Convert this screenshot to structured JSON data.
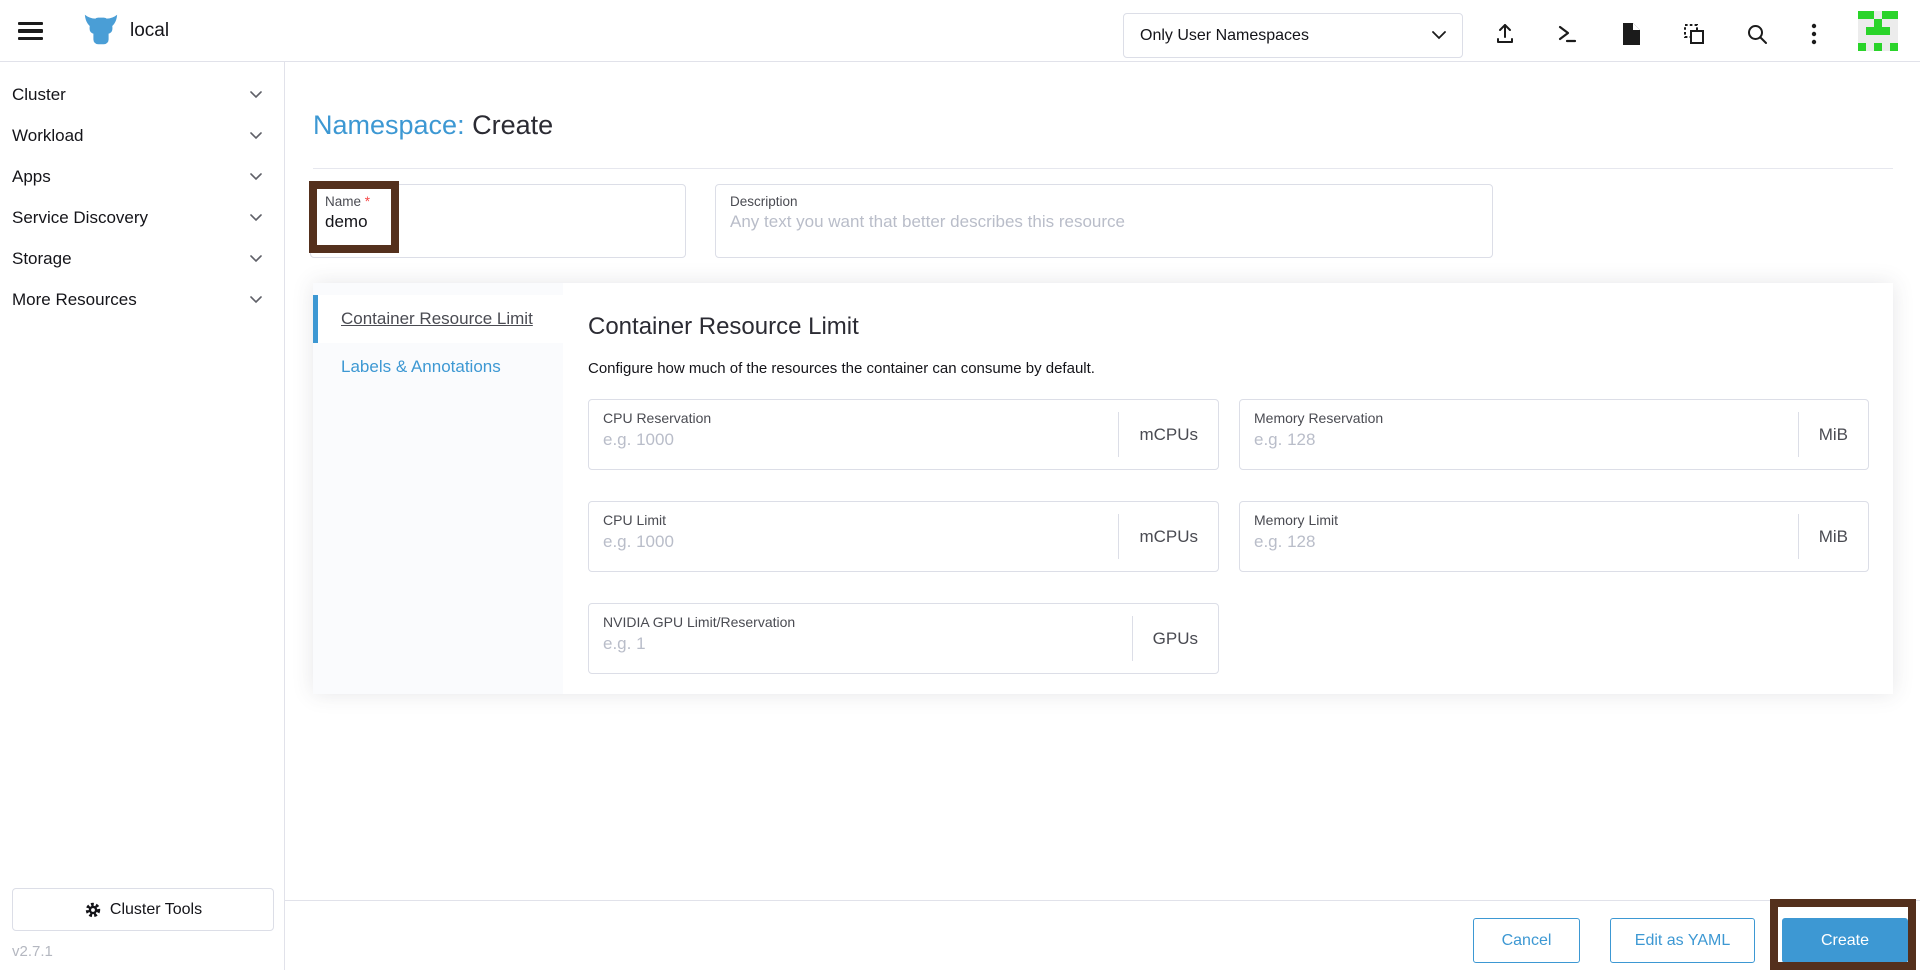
{
  "header": {
    "cluster_name": "local",
    "namespace_filter": "Only User Namespaces"
  },
  "sidebar": {
    "items": [
      {
        "label": "Cluster"
      },
      {
        "label": "Workload"
      },
      {
        "label": "Apps"
      },
      {
        "label": "Service Discovery"
      },
      {
        "label": "Storage"
      },
      {
        "label": "More Resources"
      }
    ],
    "cluster_tools_label": "Cluster Tools",
    "version": "v2.7.1"
  },
  "page": {
    "title_resource": "Namespace:",
    "title_action": "Create",
    "name_field": {
      "label": "Name",
      "required_mark": "*",
      "value": "demo"
    },
    "description_field": {
      "label": "Description",
      "placeholder": "Any text you want that better describes this resource"
    },
    "tabs": [
      {
        "label": "Container Resource Limit",
        "active": true
      },
      {
        "label": "Labels & Annotations",
        "active": false
      }
    ],
    "section": {
      "heading": "Container Resource Limit",
      "description": "Configure how much of the resources the container can consume by default.",
      "fields": [
        {
          "label": "CPU Reservation",
          "placeholder": "e.g. 1000",
          "unit": "mCPUs"
        },
        {
          "label": "Memory Reservation",
          "placeholder": "e.g. 128",
          "unit": "MiB"
        },
        {
          "label": "CPU Limit",
          "placeholder": "e.g. 1000",
          "unit": "mCPUs"
        },
        {
          "label": "Memory Limit",
          "placeholder": "e.g. 128",
          "unit": "MiB"
        },
        {
          "label": "NVIDIA GPU Limit/Reservation",
          "placeholder": "e.g. 1",
          "unit": "GPUs"
        }
      ]
    },
    "footer": {
      "cancel_label": "Cancel",
      "edit_yaml_label": "Edit as YAML",
      "create_label": "Create"
    }
  },
  "colors": {
    "accent_blue": "#3d98d3",
    "annotation_brown": "#54301d",
    "border_gray": "#dcdee7",
    "required_red": "#f64747"
  },
  "avatar": {
    "fg": "#2ad42a",
    "bg": "#ececec",
    "pattern": [
      [
        1,
        1,
        0,
        1,
        1
      ],
      [
        0,
        0,
        1,
        0,
        0
      ],
      [
        0,
        1,
        1,
        1,
        0
      ],
      [
        0,
        0,
        0,
        0,
        0
      ],
      [
        1,
        0,
        1,
        0,
        1
      ]
    ]
  }
}
